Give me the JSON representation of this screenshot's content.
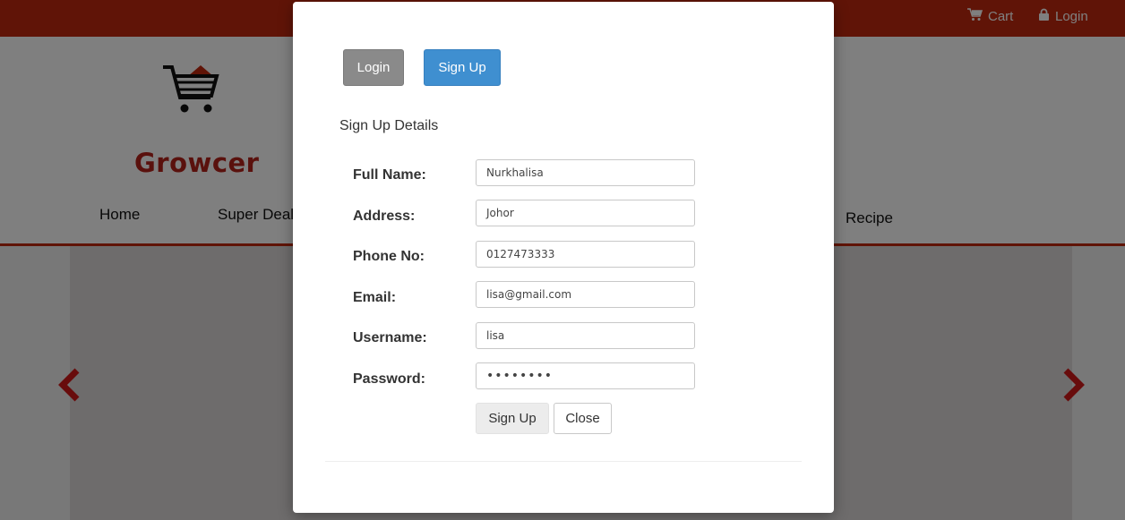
{
  "topbar": {
    "cart_label": "Cart",
    "login_label": "Login"
  },
  "logo": {
    "text": "Growcer"
  },
  "nav": {
    "items": [
      "Home",
      "Super Deal",
      "Recipe"
    ]
  },
  "modal": {
    "tabs": {
      "login": "Login",
      "signup": "Sign Up"
    },
    "section_title": "Sign Up Details",
    "fields": [
      {
        "label": "Full Name:",
        "value": "Nurkhalisa"
      },
      {
        "label": "Address:",
        "value": "Johor"
      },
      {
        "label": "Phone No:",
        "value": "0127473333"
      },
      {
        "label": "Email:",
        "value": "lisa@gmail.com"
      },
      {
        "label": "Username:",
        "value": "lisa"
      },
      {
        "label": "Password:",
        "value": "••••••••"
      }
    ],
    "submit_label": "Sign Up",
    "close_label": "Close"
  },
  "colors": {
    "brand_red": "#c0290f",
    "logo_red": "#b5221a",
    "signup_blue": "#3f8fd0",
    "login_gray": "#8a8a8a"
  }
}
